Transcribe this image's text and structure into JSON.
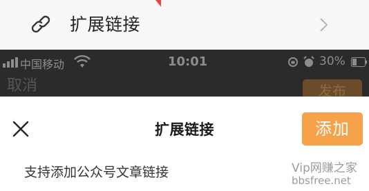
{
  "list_row": {
    "icon": "link-icon",
    "label": "扩展链接",
    "chevron_icon": "chevron-right-icon"
  },
  "status_bar": {
    "carrier": "中国移动",
    "time": "10:01",
    "battery_percent": "30%",
    "icons": [
      "signal-icon",
      "wifi-icon",
      "rotation-lock-icon",
      "alarm-icon",
      "battery-icon"
    ]
  },
  "background_page": {
    "cancel_label": "取消",
    "button_label": "发布"
  },
  "sheet": {
    "close_icon": "close-icon",
    "title": "扩展链接",
    "add_label": "添加",
    "hint": "支持添加公众号文章链接"
  },
  "watermark": {
    "line1": "Vip网赚之家",
    "line2": "bbsfree.net"
  },
  "colors": {
    "accent_orange": "#f5a24a",
    "dark_overlay": "#2b2b2b",
    "row_background": "#f7f7f7"
  }
}
